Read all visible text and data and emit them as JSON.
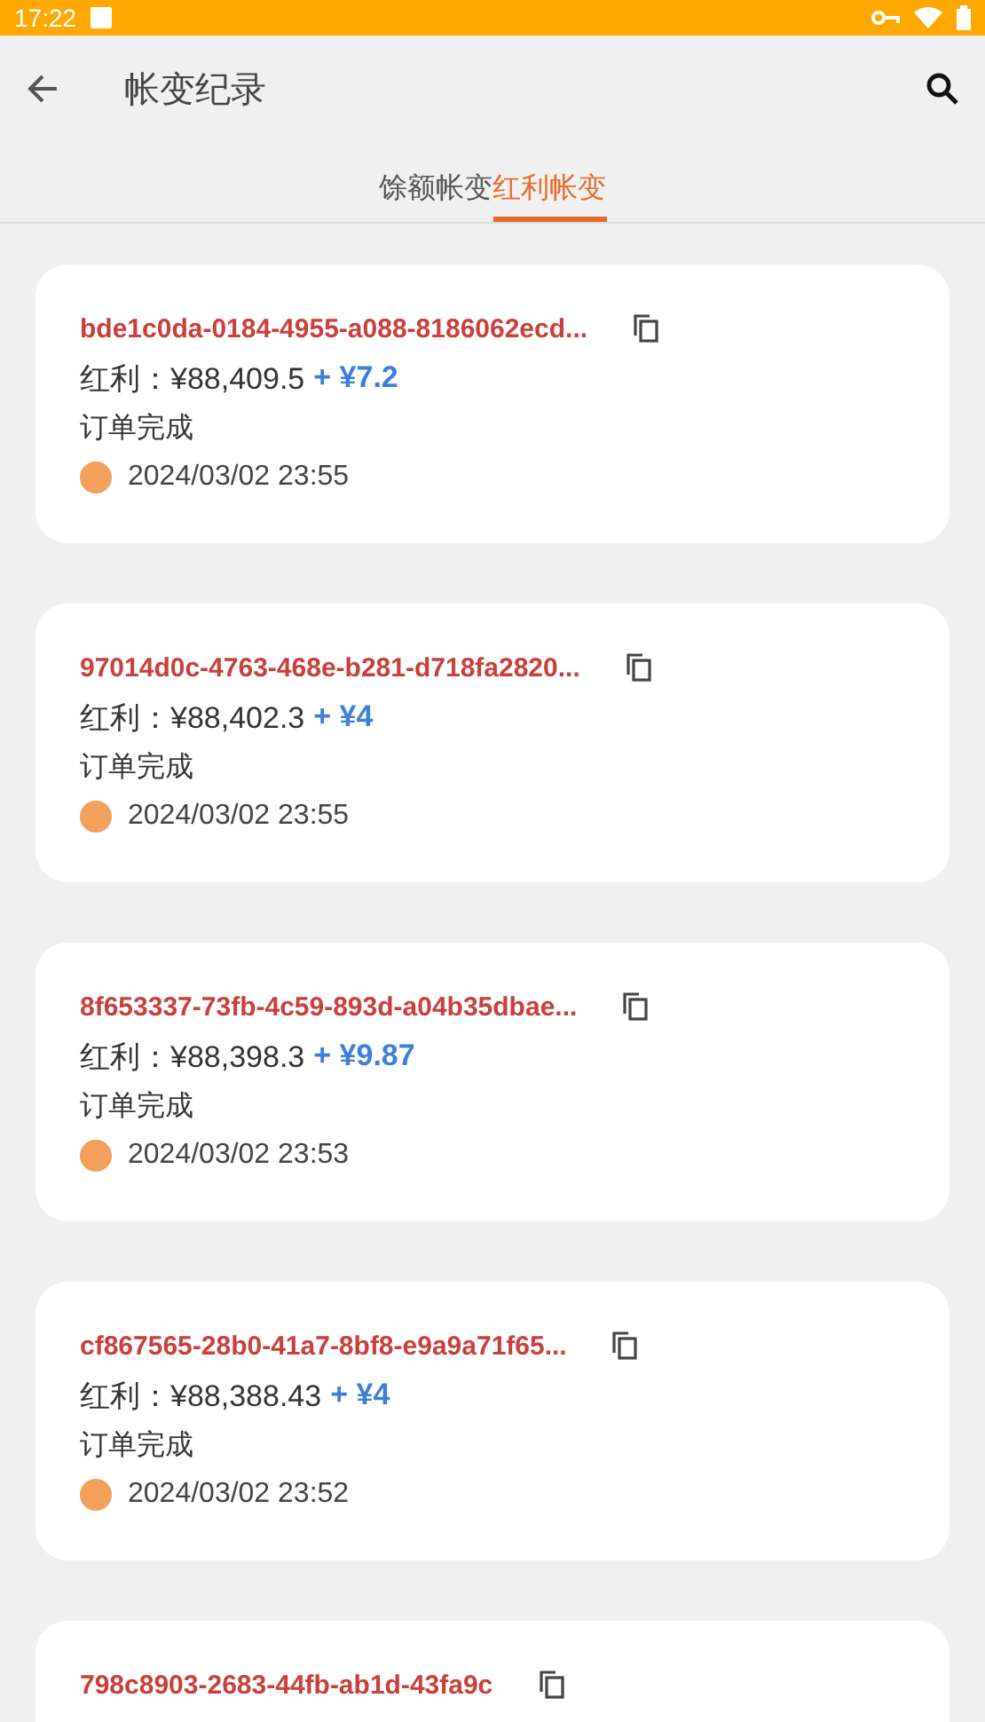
{
  "status_bar": {
    "time": "17:22"
  },
  "app_bar": {
    "title": "帐变纪录"
  },
  "tabs": [
    {
      "label": "馀额帐变",
      "selected": false
    },
    {
      "label": "红利帐变",
      "selected": true
    }
  ],
  "records": [
    {
      "id": "bde1c0da-0184-4955-a088-8186062ecd...",
      "amount": "红利：¥88,409.5",
      "change": "+ ¥7.2",
      "status": "订单完成",
      "time": "2024/03/02 23:55"
    },
    {
      "id": "97014d0c-4763-468e-b281-d718fa2820...",
      "amount": "红利：¥88,402.3",
      "change": "+ ¥4",
      "status": "订单完成",
      "time": "2024/03/02 23:55"
    },
    {
      "id": "8f653337-73fb-4c59-893d-a04b35dbae...",
      "amount": "红利：¥88,398.3",
      "change": "+ ¥9.87",
      "status": "订单完成",
      "time": "2024/03/02 23:53"
    },
    {
      "id": "cf867565-28b0-41a7-8bf8-e9a9a71f65...",
      "amount": "红利：¥88,388.43",
      "change": "+ ¥4",
      "status": "订单完成",
      "time": "2024/03/02 23:52"
    },
    {
      "id": "798c8903-2683-44fb-ab1d-43fa9c"
    }
  ]
}
